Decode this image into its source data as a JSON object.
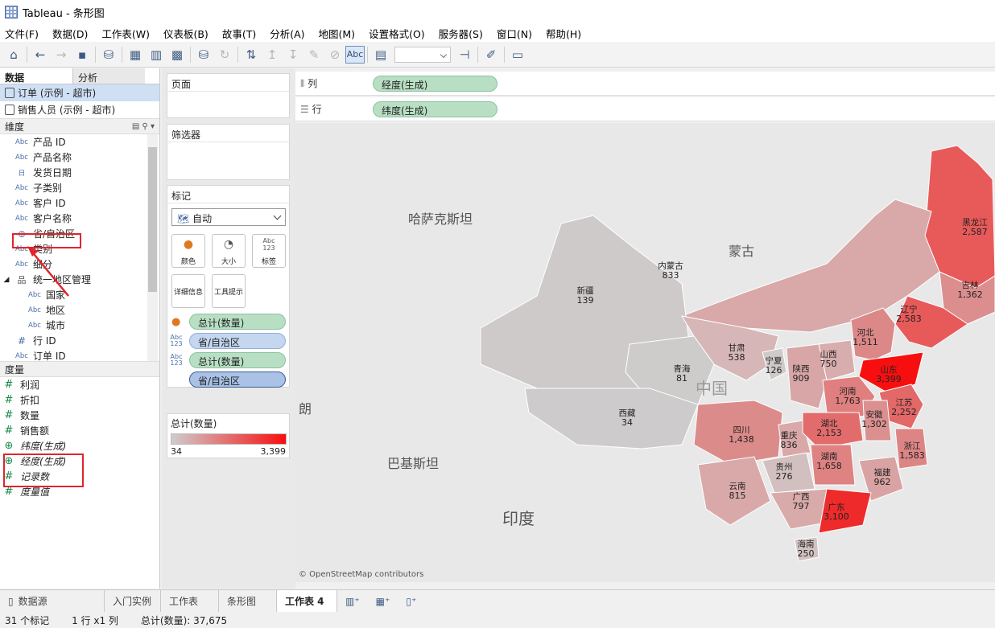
{
  "window": {
    "title": "Tableau - 条形图"
  },
  "menu": [
    "文件(F)",
    "数据(D)",
    "工作表(W)",
    "仪表板(B)",
    "故事(T)",
    "分析(A)",
    "地图(M)",
    "设置格式(O)",
    "服务器(S)",
    "窗口(N)",
    "帮助(H)"
  ],
  "toolbar": {
    "abc_label": "Abc"
  },
  "left": {
    "tab_data": "数据",
    "tab_analysis": "分析",
    "datasources": [
      "订单 (示例 - 超市)",
      "销售人员 (示例 - 超市)"
    ],
    "dimensions_label": "维度",
    "dimensions": [
      {
        "icon": "Abc",
        "name": "产品 ID"
      },
      {
        "icon": "Abc",
        "name": "产品名称"
      },
      {
        "icon": "日",
        "name": "发货日期"
      },
      {
        "icon": "Abc",
        "name": "子类别"
      },
      {
        "icon": "Abc",
        "name": "客户 ID"
      },
      {
        "icon": "Abc",
        "name": "客户名称"
      },
      {
        "icon": "globe",
        "name": "省/自治区"
      },
      {
        "icon": "Abc",
        "name": "类别"
      },
      {
        "icon": "Abc",
        "name": "细分"
      },
      {
        "icon": "hier",
        "name": "统一地区管理"
      },
      {
        "icon": "Abc",
        "name": "国家"
      },
      {
        "icon": "Abc",
        "name": "地区"
      },
      {
        "icon": "Abc",
        "name": "城市"
      },
      {
        "icon": "#",
        "name": "行 ID"
      },
      {
        "icon": "Abc",
        "name": "订单 ID"
      }
    ],
    "measures_label": "度量",
    "measures": [
      {
        "icon": "#",
        "name": "利润"
      },
      {
        "icon": "#",
        "name": "折扣"
      },
      {
        "icon": "#",
        "name": "数量"
      },
      {
        "icon": "#",
        "name": "销售额"
      },
      {
        "icon": "globe",
        "name": "纬度(生成)"
      },
      {
        "icon": "globe",
        "name": "经度(生成)"
      },
      {
        "icon": "#",
        "name": "记录数"
      },
      {
        "icon": "#",
        "name": "度量值"
      }
    ]
  },
  "cards": {
    "pages": "页面",
    "filters": "筛选器",
    "marks": "标记",
    "mark_type": "自动",
    "btn_color": "颜色",
    "btn_size": "大小",
    "btn_label": "标签",
    "btn_detail": "详细信息",
    "btn_tooltip": "工具提示",
    "pills": [
      "总计(数量)",
      "省/自治区",
      "总计(数量)",
      "省/自治区"
    ],
    "legend_title": "总计(数量)",
    "legend_min": "34",
    "legend_max": "3,399"
  },
  "shelves": {
    "columns_label": "列",
    "columns_pill": "经度(生成)",
    "rows_label": "行",
    "rows_pill": "纬度(生成)"
  },
  "map": {
    "countries": [
      {
        "name": "哈萨克斯坦"
      },
      {
        "name": "蒙古"
      },
      {
        "name": "中国"
      },
      {
        "name": "巴基斯坦"
      },
      {
        "name": "印度"
      },
      {
        "name": "朗"
      }
    ],
    "provinces": [
      {
        "name": "黑龙江",
        "value": "2,587",
        "color": "#e85a5a"
      },
      {
        "name": "内蒙古",
        "value": "833",
        "color": "#d9a8a8"
      },
      {
        "name": "吉林",
        "value": "1,362",
        "color": "#dc8e8e"
      },
      {
        "name": "辽宁",
        "value": "2,583",
        "color": "#e85a5a"
      },
      {
        "name": "新疆",
        "value": "139",
        "color": "#cfcaca"
      },
      {
        "name": "河北",
        "value": "1,511",
        "color": "#dc8888"
      },
      {
        "name": "甘肃",
        "value": "538",
        "color": "#d6b6b6"
      },
      {
        "name": "宁夏",
        "value": "126",
        "color": "#cfcaca"
      },
      {
        "name": "山西",
        "value": "750",
        "color": "#d8adad"
      },
      {
        "name": "山东",
        "value": "3,399",
        "color": "#f70f0f"
      },
      {
        "name": "青海",
        "value": "81",
        "color": "#cecbcb"
      },
      {
        "name": "陕西",
        "value": "909",
        "color": "#d8a6a6"
      },
      {
        "name": "河南",
        "value": "1,763",
        "color": "#df7f7f"
      },
      {
        "name": "江苏",
        "value": "2,252",
        "color": "#e36868"
      },
      {
        "name": "西藏",
        "value": "34",
        "color": "#cdcbcb"
      },
      {
        "name": "四川",
        "value": "1,438",
        "color": "#dc8b8b"
      },
      {
        "name": "重庆",
        "value": "836",
        "color": "#d9a8a8"
      },
      {
        "name": "湖北",
        "value": "2,153",
        "color": "#e26c6c"
      },
      {
        "name": "安徽",
        "value": "1,302",
        "color": "#db9090"
      },
      {
        "name": "浙江",
        "value": "1,583",
        "color": "#dd8585"
      },
      {
        "name": "贵州",
        "value": "276",
        "color": "#d2c0c0"
      },
      {
        "name": "湖南",
        "value": "1,658",
        "color": "#de8282"
      },
      {
        "name": "福建",
        "value": "962",
        "color": "#d9a3a3"
      },
      {
        "name": "云南",
        "value": "815",
        "color": "#d9a9a9"
      },
      {
        "name": "广西",
        "value": "797",
        "color": "#d9aaaa"
      },
      {
        "name": "广东",
        "value": "3,100",
        "color": "#ef2a2a"
      },
      {
        "name": "海南",
        "value": "250",
        "color": "#d2c2c2"
      }
    ],
    "attribution": "© OpenStreetMap contributors"
  },
  "sheets": [
    "数据源",
    "入门实例",
    "工作表",
    "条形图",
    "工作表 4"
  ],
  "status": {
    "marks": "31 个标记",
    "rows_cols": "1 行 x1 列",
    "sum": "总计(数量): 37,675"
  }
}
